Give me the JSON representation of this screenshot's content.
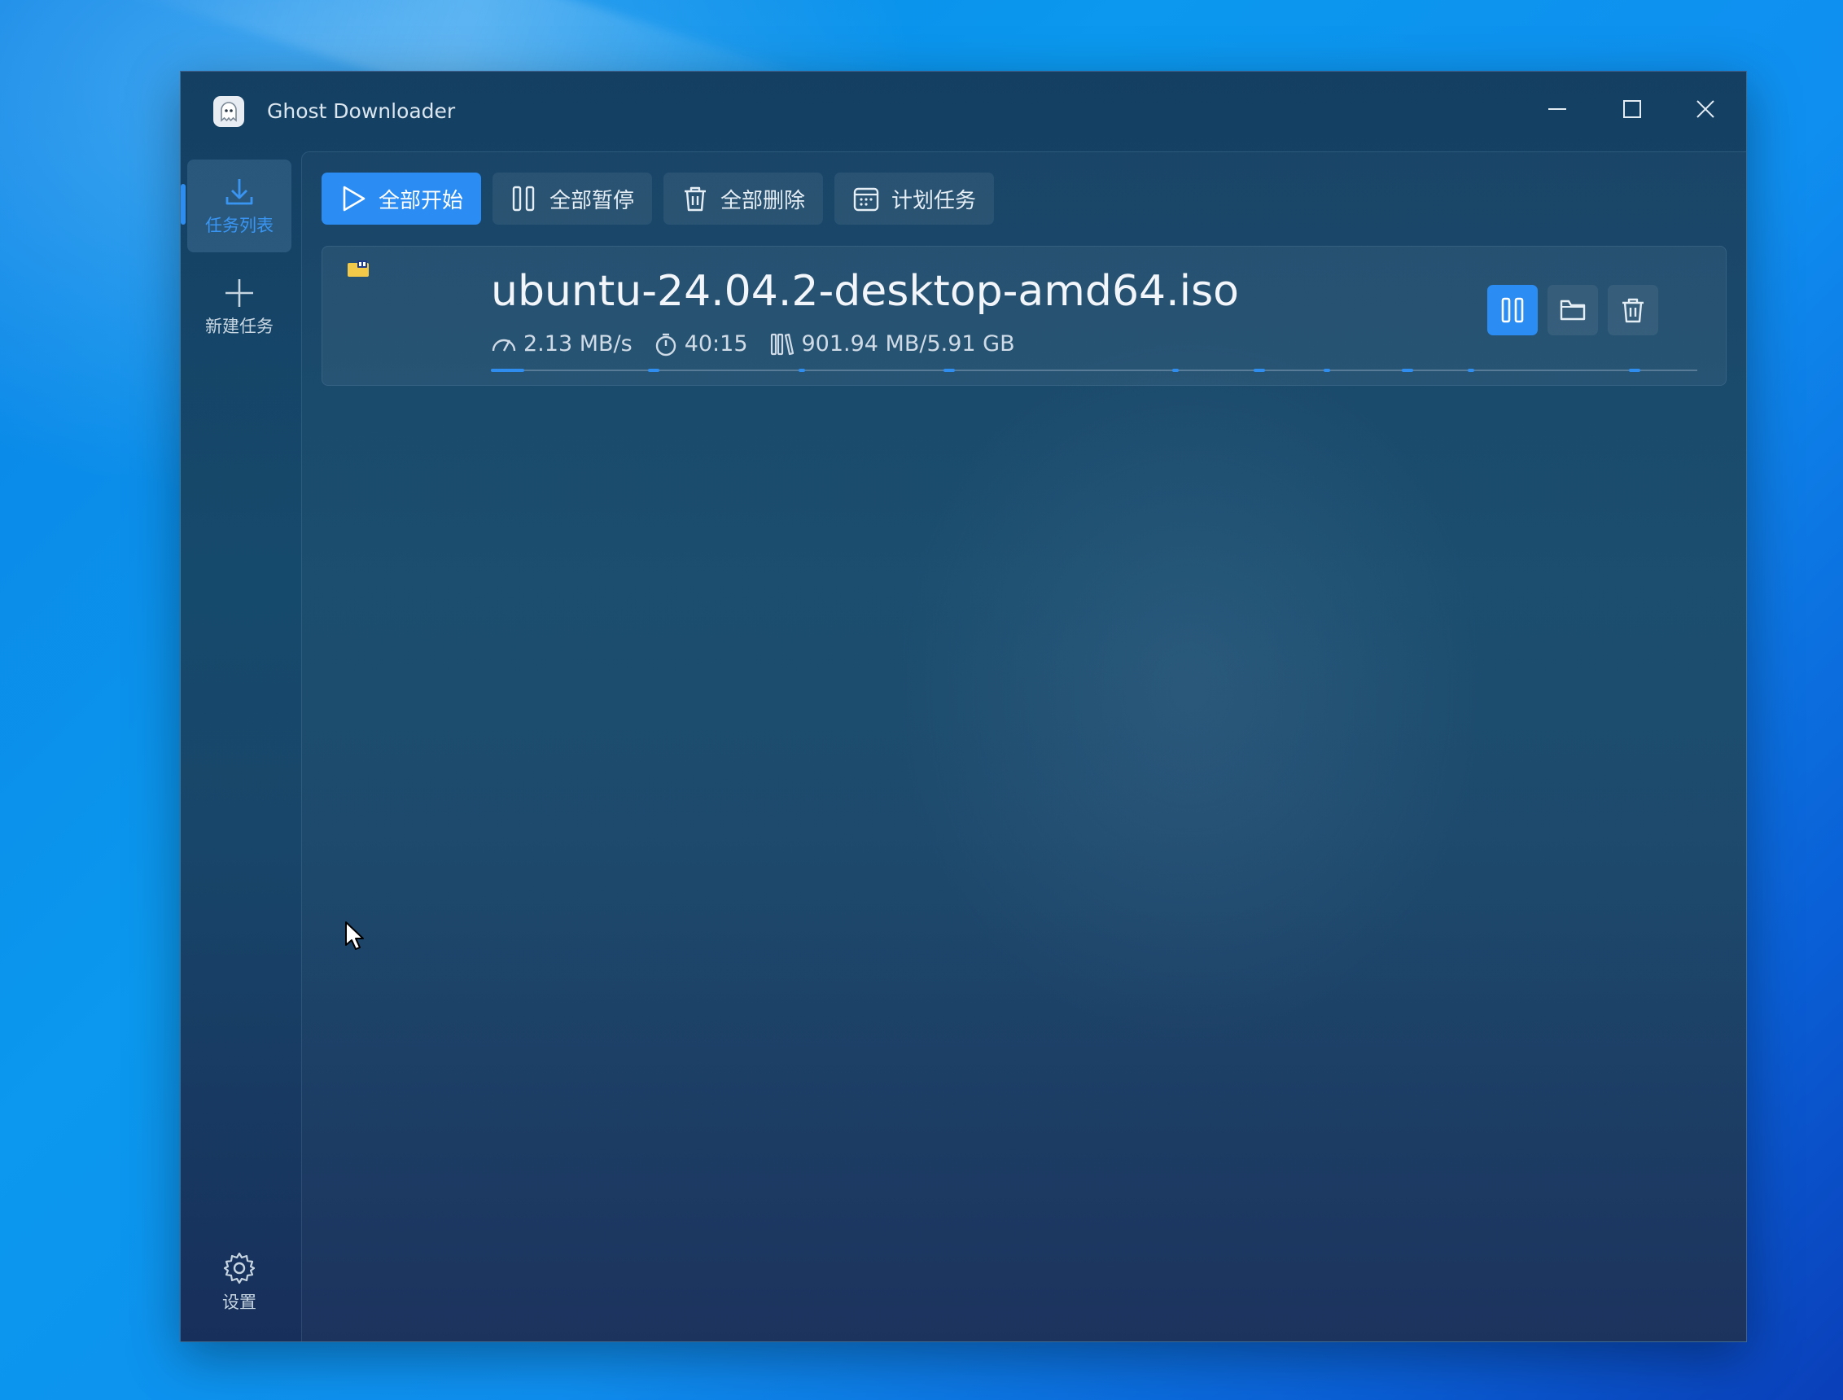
{
  "window": {
    "title": "Ghost Downloader"
  },
  "sidebar": {
    "items": [
      {
        "label": "任务列表",
        "icon": "download-icon",
        "active": true
      },
      {
        "label": "新建任务",
        "icon": "plus-icon",
        "active": false
      }
    ],
    "settings_label": "设置"
  },
  "toolbar": {
    "start_all": "全部开始",
    "pause_all": "全部暂停",
    "delete_all": "全部删除",
    "schedule": "计划任务"
  },
  "task": {
    "file_name": "ubuntu-24.04.2-desktop-amd64.iso",
    "speed": "2.13 MB/s",
    "remaining": "40:15",
    "size": "901.94 MB/5.91 GB",
    "progress_fraction": 0.149
  },
  "colors": {
    "accent": "#2b8cf4",
    "window_bg": "#164a6c"
  }
}
